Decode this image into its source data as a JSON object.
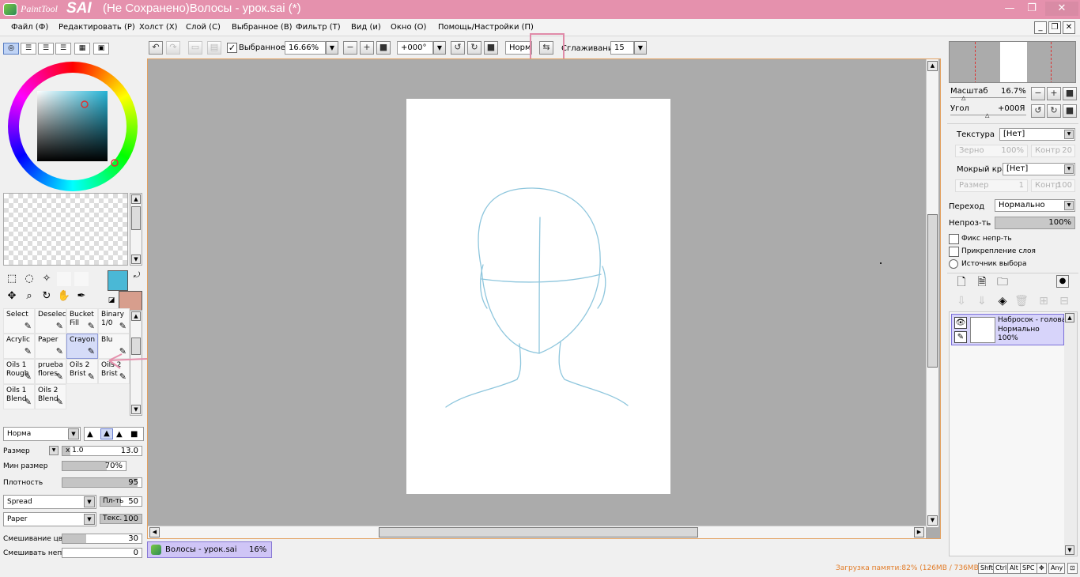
{
  "window": {
    "logo_text": "PaintTool",
    "logo_sai": "SAI",
    "title": "(Не Сохранено)Волосы - урок.sai (*)",
    "minimize": "—",
    "restore": "❐",
    "close": "✕"
  },
  "menu": {
    "items": [
      "Файл (Ф)",
      "Редактировать (Р)",
      "Холст (Х)",
      "Слой (С)",
      "Выбранное (В)",
      "Фильтр (Т)",
      "Вид (и)",
      "Окно (О)",
      "Помощь/Настройки (П)"
    ]
  },
  "toolbar": {
    "selected_label": "Выбранное",
    "selected_checked": "✓",
    "zoom": "16.66%",
    "rotation": "+000°",
    "blend_mode": "Норм",
    "smoothing_label": "Сглаживание",
    "smoothing_value": "15"
  },
  "brushes": [
    {
      "label": "Select",
      "icon": "✎"
    },
    {
      "label": "Deselect",
      "icon": "✎"
    },
    {
      "label": "Bucket Fill",
      "icon": "✎"
    },
    {
      "label": "Binary 1/0",
      "icon": "✎"
    },
    {
      "label": "Acrylic",
      "icon": "✎"
    },
    {
      "label": "Paper",
      "icon": "✎"
    },
    {
      "label": "Crayon",
      "icon": "✎"
    },
    {
      "label": "Blu",
      "icon": "✎"
    },
    {
      "label": "Oils 1 Rough",
      "icon": "✎"
    },
    {
      "label": "prueba flores",
      "icon": "✎"
    },
    {
      "label": "Oils 2 Brist",
      "icon": "✎"
    },
    {
      "label": "Oils 2 Brist",
      "icon": "✎"
    },
    {
      "label": "Oils 1 Blend",
      "icon": "✎"
    },
    {
      "label": "Oils 2 Blend",
      "icon": "✎"
    }
  ],
  "brush_settings": {
    "mode": "Норма",
    "size_label": "Размер",
    "size_multiplier": "x 1.0",
    "size_value": "13.0",
    "min_size_label": "Мин размер",
    "min_size_value": "70%",
    "min_size_fraction": 0.7,
    "density_label": "Плотность",
    "density_value": "95",
    "density_fraction": 0.95,
    "shape": "Spread",
    "shape_strength_label": "Пл-ть",
    "shape_strength_value": "50",
    "texture": "Paper",
    "texture_strength_label": "Текс.",
    "texture_strength_value": "100",
    "blend_color_label": "Смешивание цвет",
    "blend_color_value": "30",
    "blend_opacity_label": "Смешивать непро",
    "blend_opacity_value": "0"
  },
  "colors": {
    "primary": "#4ab8d6",
    "secondary": "#d79e8d",
    "accent": "#e591ad"
  },
  "navigator": {
    "zoom_label": "Масштаб",
    "zoom_value": "16.7%",
    "angle_label": "Угол",
    "angle_value": "+000Я"
  },
  "layer_props": {
    "texture_label": "Текстура",
    "texture_value": "[Нет]",
    "grain_label": "Зерно",
    "grain_value": "100%",
    "contrast_label": "Контр",
    "contrast_value": "20",
    "wet_edge_label": "Мокрый край",
    "wet_edge_value": "[Нет]",
    "size_label": "Размер",
    "size_value": "1",
    "contr2_label": "Контр",
    "contr2_value": "100",
    "transition_label": "Переход",
    "transition_value": "Нормально",
    "opacity_label": "Непроз-ть",
    "opacity_value": "100%",
    "fix_opacity": "Фикс непр-ть",
    "clip_layer": "Прикрепление слоя",
    "selection_source": "Источник выбора"
  },
  "layers": [
    {
      "name": "Набросок - голова",
      "mode": "Нормально",
      "opacity": "100%"
    }
  ],
  "file_tab": {
    "name": "Волосы - урок.sai",
    "zoom": "16%"
  },
  "status": {
    "memory": "Загрузка памяти:82% (126MB / 736MB)",
    "keys": [
      "Shft",
      "Ctrl",
      "Alt",
      "SPC",
      "✥",
      "Any"
    ]
  }
}
